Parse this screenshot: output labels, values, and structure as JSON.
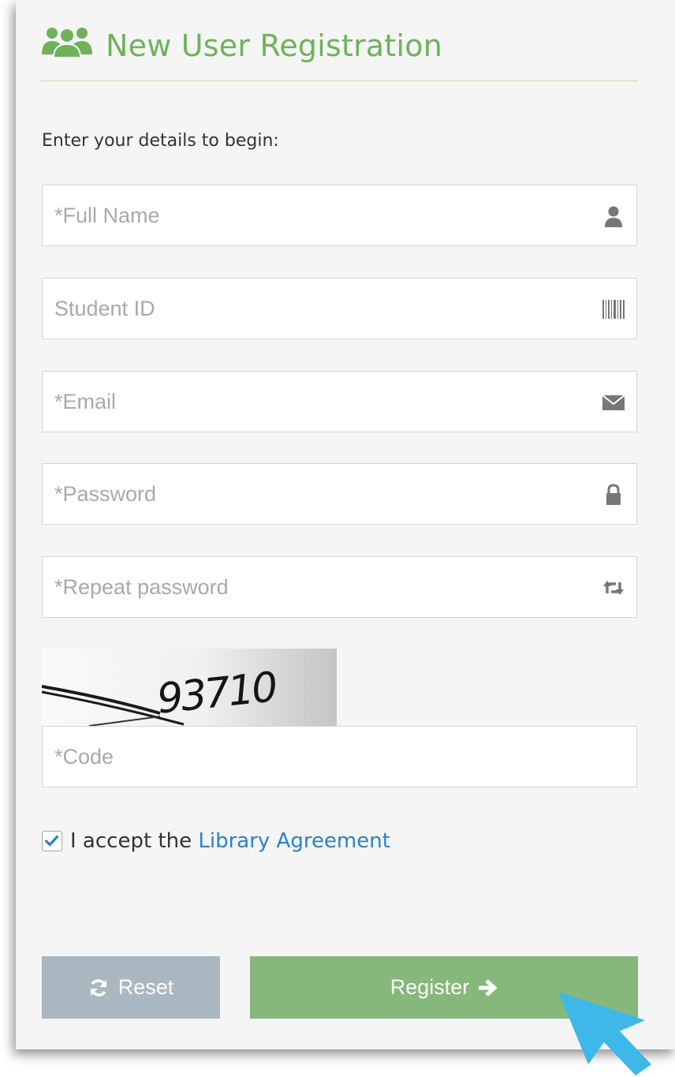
{
  "header": {
    "icon": "users-icon",
    "title": "New User Registration",
    "accent_color": "#6fb25a"
  },
  "form": {
    "intro": "Enter your details to begin:",
    "fields": {
      "full_name": {
        "placeholder": "*Full Name",
        "icon": "user-icon"
      },
      "student_id": {
        "placeholder": "Student ID",
        "icon": "barcode-icon"
      },
      "email": {
        "placeholder": "*Email",
        "icon": "envelope-icon"
      },
      "password": {
        "placeholder": "*Password",
        "icon": "lock-icon"
      },
      "repeat_password": {
        "placeholder": "*Repeat password",
        "icon": "retweet-icon"
      },
      "code": {
        "placeholder": "*Code"
      }
    },
    "captcha": {
      "text": "93710"
    },
    "agreement": {
      "checked": true,
      "prefix": "I accept the",
      "link_text": "Library Agreement",
      "link_color": "#2b82c9"
    },
    "buttons": {
      "reset": {
        "label": "Reset",
        "icon": "refresh-icon",
        "color": "#a9b7c1"
      },
      "register": {
        "label": "Register",
        "icon": "arrow-right-icon",
        "color": "#85b87a"
      }
    }
  },
  "cursor": {
    "icon": "mouse-pointer-icon",
    "color": "#3db8e8"
  }
}
